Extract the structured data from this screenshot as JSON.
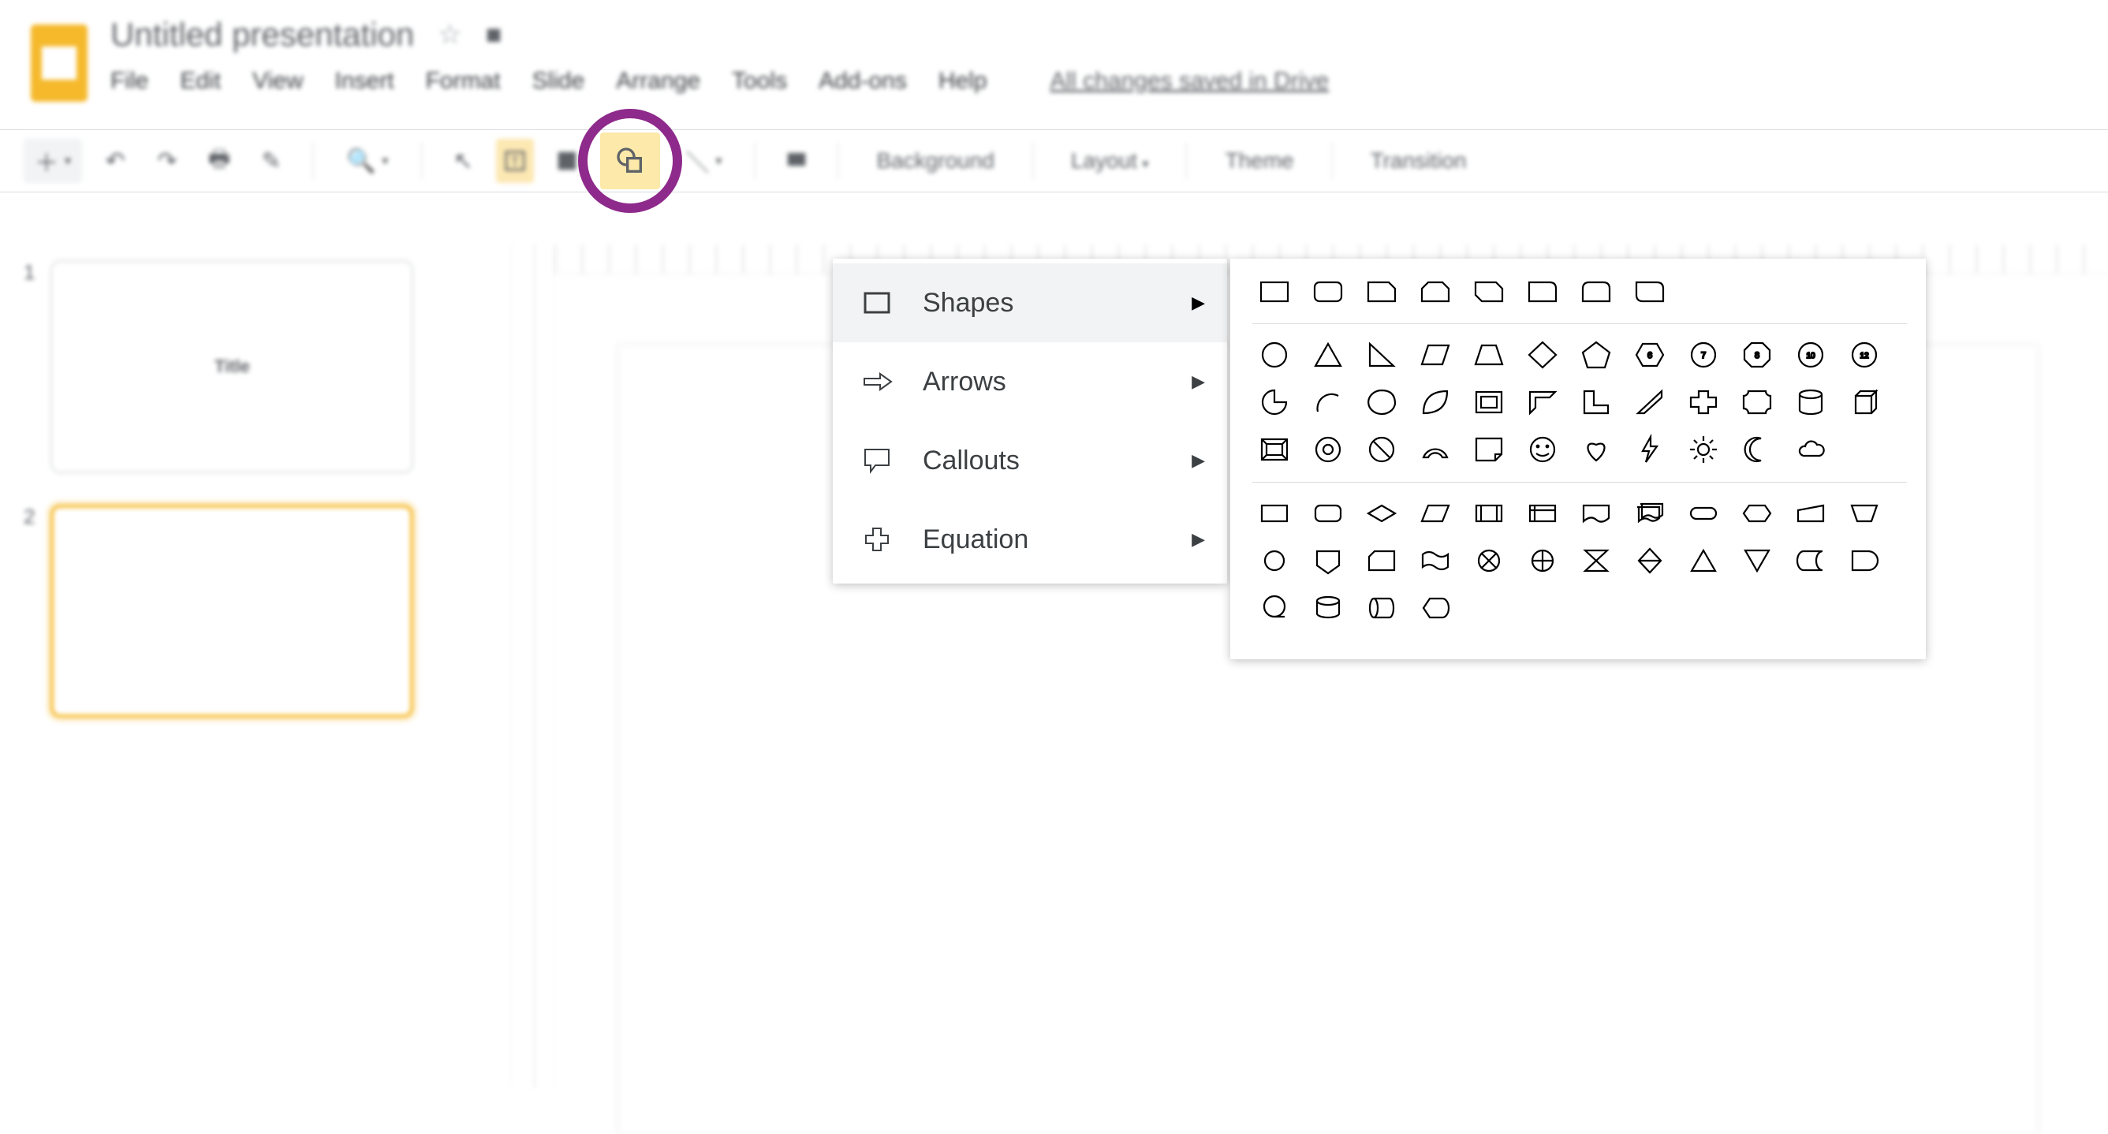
{
  "header": {
    "doc_title": "Untitled presentation",
    "star_tooltip": "Star",
    "move_tooltip": "Move to",
    "saved_label": "All changes saved in Drive"
  },
  "menu": {
    "file": "File",
    "edit": "Edit",
    "view": "View",
    "insert": "Insert",
    "format": "Format",
    "slide": "Slide",
    "arrange": "Arrange",
    "tools": "Tools",
    "addons": "Add-ons",
    "help": "Help"
  },
  "toolbar": {
    "background": "Background",
    "layout": "Layout",
    "theme": "Theme",
    "transition": "Transition"
  },
  "annotations": {
    "shape_button_highlight": "purple-circle"
  },
  "slide_panel": {
    "slides": [
      {
        "num": "1",
        "label": "Title",
        "selected": false
      },
      {
        "num": "2",
        "label": "",
        "selected": true
      }
    ]
  },
  "shape_menu": {
    "items": [
      {
        "icon": "rect-outline",
        "label": "Shapes",
        "hover": true
      },
      {
        "icon": "arrow-right",
        "label": "Arrows",
        "hover": false
      },
      {
        "icon": "callout-rect",
        "label": "Callouts",
        "hover": false
      },
      {
        "icon": "plus-outline",
        "label": "Equation",
        "hover": false
      }
    ]
  },
  "shapes_picker": {
    "section1": [
      "rect",
      "round-rect",
      "snip1",
      "snip-same",
      "snip-diag",
      "round1",
      "round-same",
      "round-diag"
    ],
    "section2_row1": [
      "circle",
      "triangle",
      "right-triangle",
      "parallelogram",
      "trapezoid",
      "diamond",
      "pentagon",
      "hexagon-6",
      "heptagon-7",
      "octagon-8",
      "decagon-10",
      "dodecagon-12"
    ],
    "section2_row2": [
      "pie",
      "chord",
      "teardrop",
      "leaf",
      "frame",
      "half-frame",
      "l-shape",
      "diag-stripe",
      "cross",
      "plaque",
      "can",
      "cube"
    ],
    "section2_row3": [
      "bevel",
      "donut",
      "no-symbol",
      "block-arc",
      "folded-corner",
      "smiley",
      "heart",
      "lightning",
      "sun",
      "moon",
      "cloud"
    ],
    "section3_row1": [
      "flow-rect",
      "round-rect",
      "decision",
      "parallelogram",
      "predef",
      "internal",
      "document",
      "multidoc",
      "terminator",
      "display",
      "manual-input",
      "trap-alt"
    ],
    "section3_row2": [
      "connector",
      "shield",
      "drum-side",
      "wave",
      "or",
      "summing",
      "collate",
      "sort",
      "tri-up",
      "tri-down",
      "half-moon",
      "delay"
    ],
    "section3_row3": [
      "magnifier",
      "storage",
      "disk",
      "display-alt"
    ]
  }
}
